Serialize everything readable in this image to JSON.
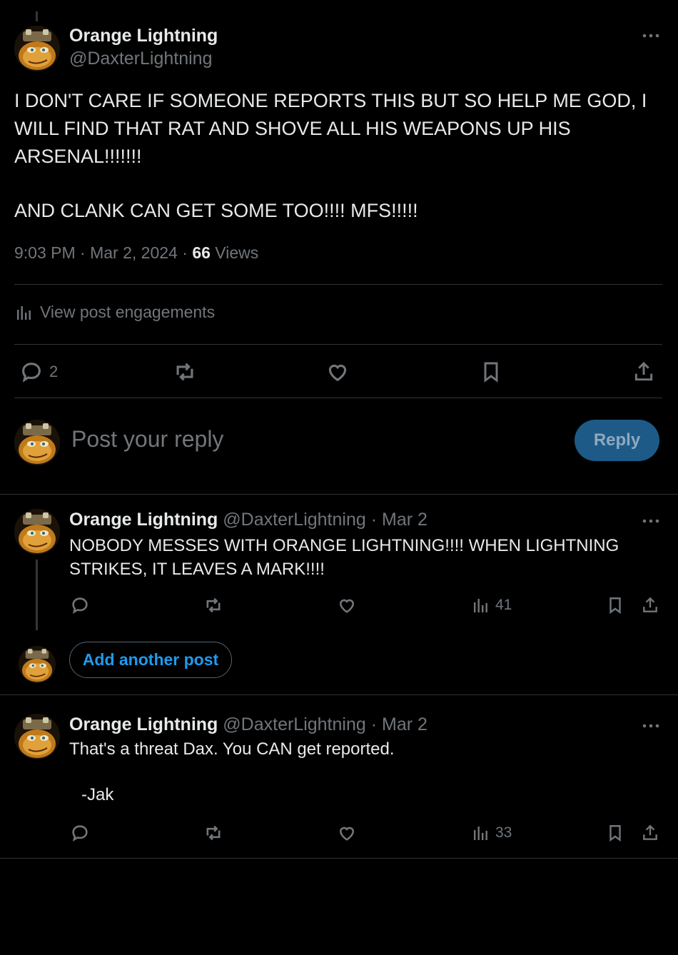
{
  "main_post": {
    "display_name": "Orange Lightning",
    "handle": "@DaxterLightning",
    "text_line1": "I DON'T CARE IF SOMEONE REPORTS THIS BUT SO HELP ME GOD, I",
    "text_line2": "WILL FIND THAT RAT AND SHOVE ALL HIS WEAPONS UP HIS",
    "text_line3": "ARSENAL!!!!!!!",
    "text_line4": "AND CLANK CAN GET SOME TOO!!!! MFS!!!!!",
    "time": "9:03 PM",
    "sep1": "·",
    "date": "Mar 2, 2024",
    "sep2": "·",
    "views_count": "66",
    "views_label": "Views",
    "engagements_label": "View post engagements",
    "reply_count": "2"
  },
  "composer": {
    "placeholder": "Post your reply",
    "reply_button": "Reply"
  },
  "reply1": {
    "display_name": "Orange Lightning",
    "handle": "@DaxterLightning",
    "date": "· Mar 2",
    "text_line1": "NOBODY MESSES WITH ORANGE LIGHTNING!!!! WHEN LIGHTNING",
    "text_line2": "STRIKES, IT LEAVES A MARK!!!!",
    "views": "41"
  },
  "add_another": {
    "label": "Add another post"
  },
  "reply2": {
    "display_name": "Orange Lightning",
    "handle": "@DaxterLightning",
    "date": "· Mar 2",
    "text_line1": "That's a threat Dax. You CAN get reported.",
    "text_line2": "-Jak",
    "views": "33"
  },
  "colors": {
    "background": "#000000",
    "text": "#e7e9ea",
    "muted": "#71767b",
    "divider": "#2f3336",
    "accent": "#1d9bf0",
    "reply_button_disabled": "#1d5a87"
  },
  "icons": [
    "more-icon",
    "reply-icon",
    "repost-icon",
    "like-icon",
    "bookmark-icon",
    "share-icon",
    "analytics-icon",
    "avatar-daxter"
  ]
}
